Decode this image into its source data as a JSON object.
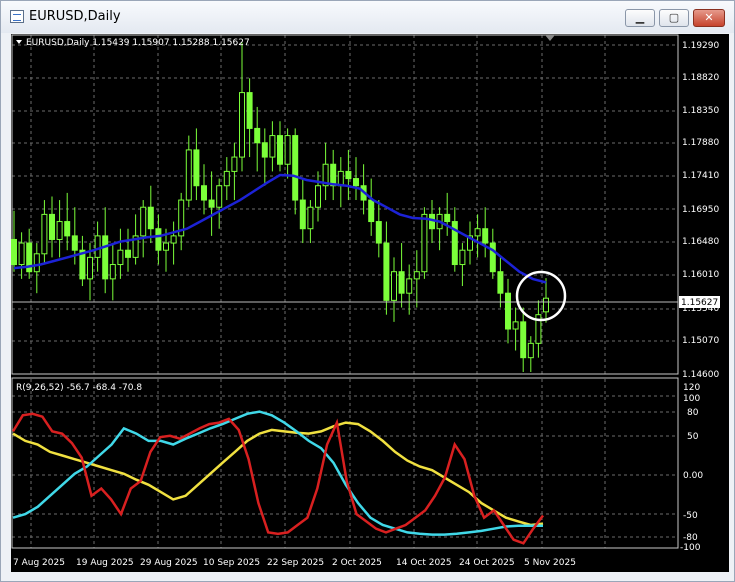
{
  "window": {
    "title": "EURUSD,Daily",
    "buttons": {
      "minimize": "▁",
      "maximize": "▢",
      "close": "✕"
    }
  },
  "chart": {
    "header": "EURUSD,Daily  1.15439 1.15907 1.15288 1.15627",
    "price_ticks": [
      "1.19290",
      "1.18820",
      "1.18350",
      "1.17880",
      "1.17410",
      "1.16950",
      "1.16480",
      "1.16010",
      "1.15540",
      "1.15070",
      "1.14600"
    ],
    "current_price": "1.15627",
    "indicator_label": "R(9,26,52) -56.7 -68.4 -70.8",
    "indicator_ticks": [
      "120",
      "100",
      "80",
      "50",
      "0.00",
      "-50",
      "-80",
      "-100"
    ],
    "date_ticks": [
      "7 Aug 2025",
      "19 Aug 2025",
      "29 Aug 2025",
      "10 Sep 2025",
      "22 Sep 2025",
      "2 Oct 2025",
      "14 Oct 2025",
      "24 Oct 2025",
      "5 Nov 2025"
    ],
    "colors": {
      "background": "#000000",
      "candle": "#7cff3a",
      "ma": "#1c22d6",
      "grid": "#6b6b6b",
      "r_fast": "#d82020",
      "r_mid": "#f0e040",
      "r_slow": "#40d8e8",
      "highlight": "#ffffff"
    }
  },
  "chart_data": {
    "type": "candlestick",
    "symbol": "EURUSD",
    "timeframe": "Daily",
    "last_ohlc": {
      "open": 1.15439,
      "high": 1.15907,
      "low": 1.15288,
      "close": 1.15627
    },
    "price_range": [
      1.146,
      1.1929
    ],
    "candles": [
      [
        1.1645,
        1.1685,
        1.16,
        1.161
      ],
      [
        1.161,
        1.1655,
        1.159,
        1.164
      ],
      [
        1.164,
        1.166,
        1.159,
        1.16
      ],
      [
        1.16,
        1.164,
        1.157,
        1.1625
      ],
      [
        1.1625,
        1.17,
        1.161,
        1.168
      ],
      [
        1.168,
        1.1705,
        1.162,
        1.1645
      ],
      [
        1.1645,
        1.17,
        1.162,
        1.167
      ],
      [
        1.167,
        1.171,
        1.163,
        1.165
      ],
      [
        1.165,
        1.169,
        1.161,
        1.163
      ],
      [
        1.163,
        1.165,
        1.158,
        1.159
      ],
      [
        1.159,
        1.164,
        1.156,
        1.162
      ],
      [
        1.162,
        1.167,
        1.16,
        1.165
      ],
      [
        1.165,
        1.169,
        1.157,
        1.159
      ],
      [
        1.159,
        1.164,
        1.156,
        1.161
      ],
      [
        1.161,
        1.166,
        1.159,
        1.163
      ],
      [
        1.163,
        1.166,
        1.16,
        1.162
      ],
      [
        1.162,
        1.168,
        1.161,
        1.165
      ],
      [
        1.165,
        1.17,
        1.162,
        1.169
      ],
      [
        1.169,
        1.172,
        1.164,
        1.166
      ],
      [
        1.166,
        1.168,
        1.161,
        1.163
      ],
      [
        1.163,
        1.166,
        1.16,
        1.164
      ],
      [
        1.164,
        1.167,
        1.161,
        1.165
      ],
      [
        1.165,
        1.171,
        1.163,
        1.17
      ],
      [
        1.17,
        1.179,
        1.169,
        1.177
      ],
      [
        1.177,
        1.18,
        1.17,
        1.172
      ],
      [
        1.172,
        1.175,
        1.168,
        1.17
      ],
      [
        1.17,
        1.174,
        1.165,
        1.169
      ],
      [
        1.169,
        1.173,
        1.166,
        1.172
      ],
      [
        1.172,
        1.176,
        1.17,
        1.174
      ],
      [
        1.174,
        1.178,
        1.17,
        1.176
      ],
      [
        1.176,
        1.192,
        1.174,
        1.185
      ],
      [
        1.185,
        1.187,
        1.176,
        1.18
      ],
      [
        1.18,
        1.183,
        1.174,
        1.178
      ],
      [
        1.178,
        1.18,
        1.172,
        1.176
      ],
      [
        1.176,
        1.181,
        1.174,
        1.179
      ],
      [
        1.179,
        1.181,
        1.174,
        1.175
      ],
      [
        1.175,
        1.18,
        1.173,
        1.179
      ],
      [
        1.179,
        1.18,
        1.168,
        1.17
      ],
      [
        1.17,
        1.173,
        1.164,
        1.166
      ],
      [
        1.166,
        1.17,
        1.164,
        1.169
      ],
      [
        1.169,
        1.174,
        1.167,
        1.172
      ],
      [
        1.172,
        1.178,
        1.17,
        1.175
      ],
      [
        1.175,
        1.177,
        1.17,
        1.172
      ],
      [
        1.172,
        1.176,
        1.169,
        1.174
      ],
      [
        1.174,
        1.177,
        1.17,
        1.173
      ],
      [
        1.173,
        1.176,
        1.17,
        1.172
      ],
      [
        1.172,
        1.175,
        1.168,
        1.17
      ],
      [
        1.17,
        1.173,
        1.165,
        1.167
      ],
      [
        1.167,
        1.17,
        1.162,
        1.164
      ],
      [
        1.164,
        1.167,
        1.154,
        1.156
      ],
      [
        1.156,
        1.162,
        1.153,
        1.16
      ],
      [
        1.16,
        1.164,
        1.155,
        1.157
      ],
      [
        1.157,
        1.161,
        1.154,
        1.159
      ],
      [
        1.159,
        1.163,
        1.155,
        1.16
      ],
      [
        1.16,
        1.169,
        1.159,
        1.168
      ],
      [
        1.168,
        1.17,
        1.164,
        1.166
      ],
      [
        1.166,
        1.169,
        1.163,
        1.168
      ],
      [
        1.168,
        1.171,
        1.165,
        1.167
      ],
      [
        1.167,
        1.169,
        1.16,
        1.161
      ],
      [
        1.161,
        1.164,
        1.158,
        1.163
      ],
      [
        1.163,
        1.167,
        1.161,
        1.165
      ],
      [
        1.165,
        1.168,
        1.162,
        1.166
      ],
      [
        1.166,
        1.169,
        1.162,
        1.164
      ],
      [
        1.164,
        1.166,
        1.159,
        1.16
      ],
      [
        1.16,
        1.162,
        1.155,
        1.157
      ],
      [
        1.157,
        1.159,
        1.15,
        1.152
      ],
      [
        1.152,
        1.155,
        1.149,
        1.153
      ],
      [
        1.153,
        1.155,
        1.146,
        1.148
      ],
      [
        1.148,
        1.151,
        1.146,
        1.15
      ],
      [
        1.15,
        1.156,
        1.148,
        1.154
      ],
      [
        1.1544,
        1.1591,
        1.1529,
        1.1563
      ]
    ],
    "ma_series": [
      1.1605,
      1.1607,
      1.161,
      1.1615,
      1.162,
      1.1625,
      1.163,
      1.1636,
      1.1642,
      1.1645,
      1.1648,
      1.165,
      1.1655,
      1.166,
      1.167,
      1.168,
      1.169,
      1.17,
      1.1712,
      1.1724,
      1.1735,
      1.1734,
      1.1728,
      1.1725,
      1.1722,
      1.172,
      1.1716,
      1.17,
      1.169,
      1.168,
      1.1675,
      1.1674,
      1.167,
      1.166,
      1.165,
      1.164,
      1.163,
      1.1615,
      1.16,
      1.159,
      1.1585
    ],
    "indicator": {
      "name": "R(9,26,52)",
      "values": [
        -56.7,
        -68.4,
        -70.8
      ],
      "range": [
        -100,
        120
      ],
      "series_fast": [
        58,
        80,
        82,
        78,
        58,
        55,
        42,
        22,
        -30,
        -20,
        -35,
        -55,
        -20,
        -10,
        30,
        50,
        52,
        48,
        55,
        62,
        68,
        70,
        75,
        60,
        20,
        -40,
        -80,
        -82,
        -80,
        -70,
        -60,
        -20,
        40,
        70,
        -10,
        -55,
        -65,
        -75,
        -80,
        -75,
        -70,
        -60,
        -50,
        -30,
        -5,
        40,
        20,
        -30,
        -60,
        -50,
        -70,
        -90,
        -95,
        -75,
        -57
      ],
      "series_mid": [
        55,
        45,
        40,
        30,
        25,
        20,
        15,
        10,
        5,
        0,
        -8,
        -15,
        -25,
        -35,
        -30,
        -15,
        0,
        15,
        30,
        45,
        55,
        60,
        58,
        56,
        55,
        58,
        65,
        70,
        68,
        58,
        45,
        30,
        18,
        10,
        5,
        -5,
        -15,
        -25,
        -40,
        -50,
        -60,
        -65,
        -70,
        -68
      ],
      "series_slow": [
        -60,
        -55,
        -45,
        -30,
        -15,
        0,
        10,
        25,
        40,
        62,
        55,
        45,
        45,
        40,
        48,
        55,
        62,
        68,
        75,
        82,
        85,
        80,
        70,
        58,
        45,
        35,
        15,
        -15,
        -40,
        -60,
        -70,
        -75,
        -80,
        -82,
        -83,
        -83,
        -82,
        -80,
        -78,
        -75,
        -72,
        -71,
        -71,
        -71
      ]
    }
  }
}
